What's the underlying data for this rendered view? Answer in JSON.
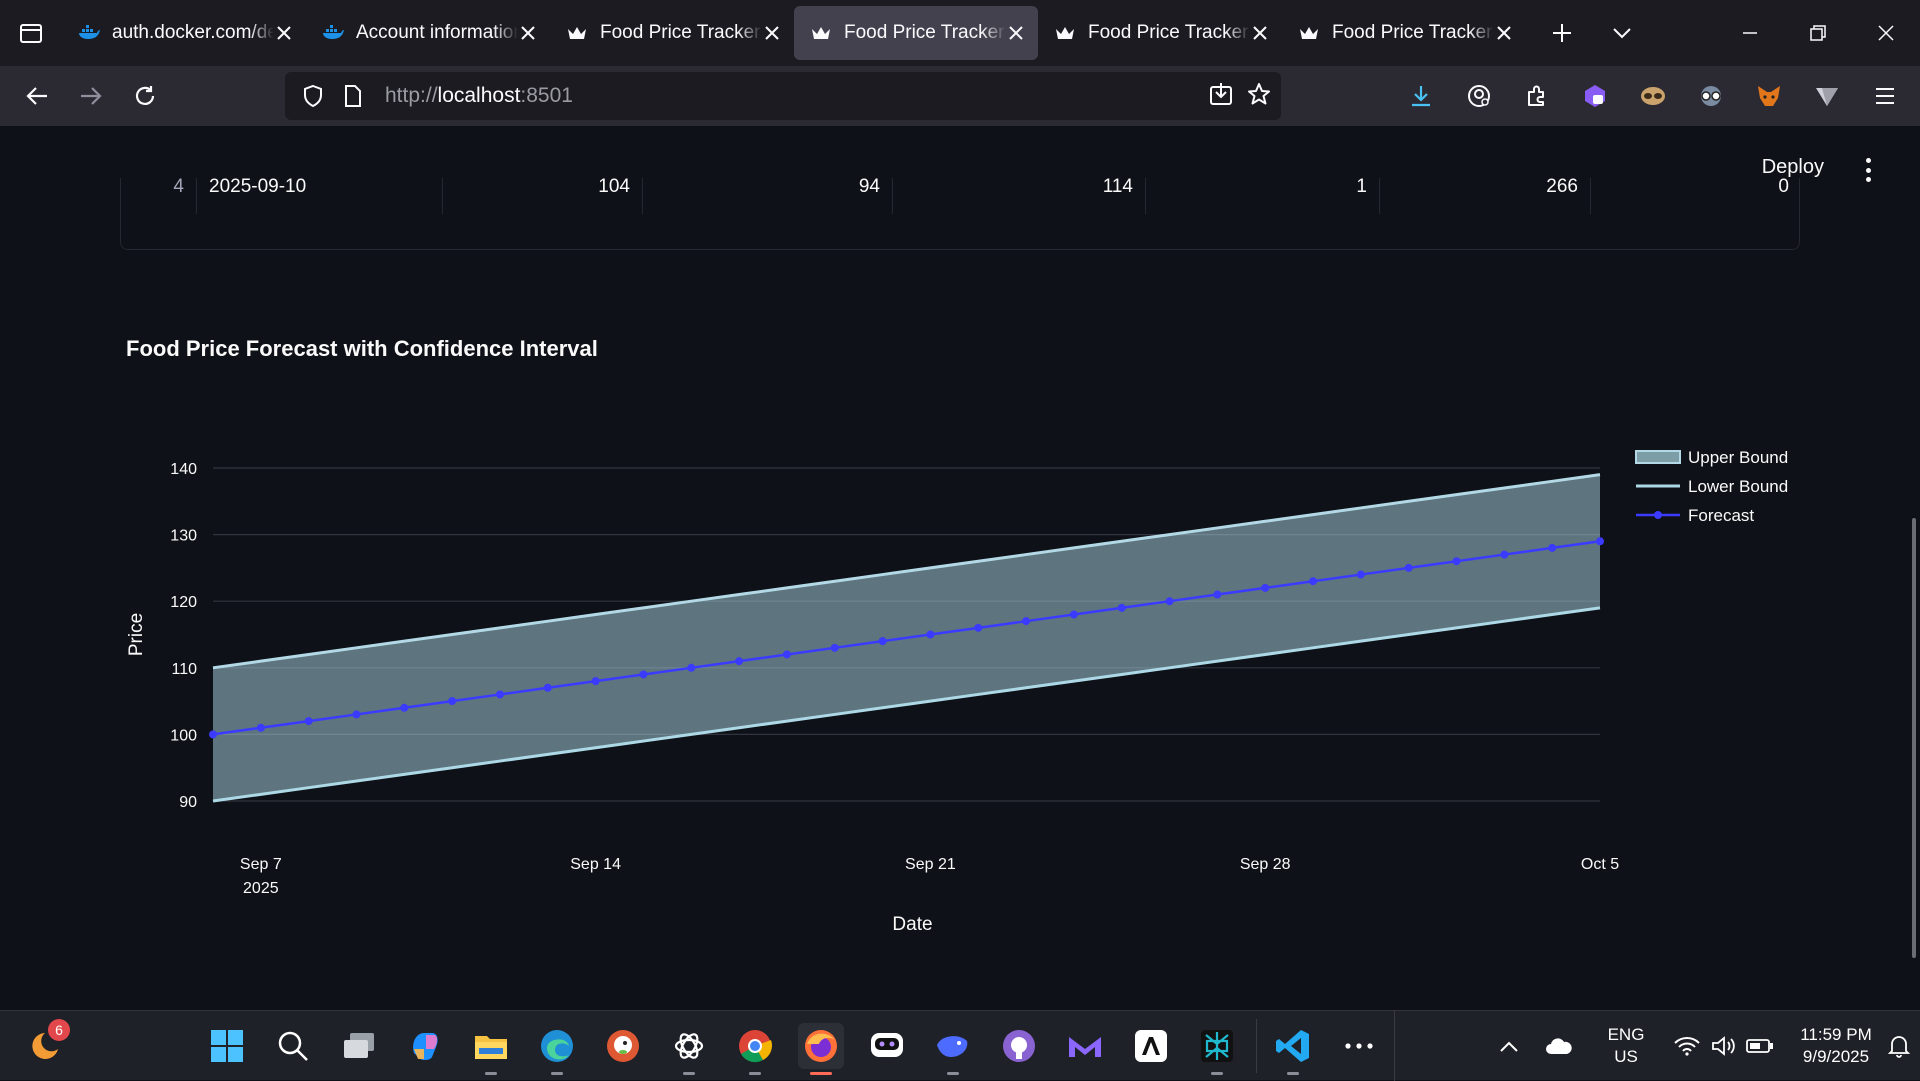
{
  "browser": {
    "tabs": [
      {
        "title": "auth.docker.com/de",
        "favicon": "docker-icon",
        "active": false
      },
      {
        "title": "Account information",
        "favicon": "docker-icon",
        "active": false
      },
      {
        "title": "Food Price Tracker D",
        "favicon": "streamlit-crown-icon",
        "active": false
      },
      {
        "title": "Food Price Tracker D",
        "favicon": "streamlit-crown-icon",
        "active": true
      },
      {
        "title": "Food Price Tracker D",
        "favicon": "streamlit-crown-icon",
        "active": false
      },
      {
        "title": "Food Price Tracker D",
        "favicon": "streamlit-crown-icon",
        "active": false
      }
    ],
    "url_prefix": "http://",
    "url_host": "localhost",
    "url_port": ":8501"
  },
  "app": {
    "deploy_label": "Deploy",
    "table_row": {
      "index": "4",
      "date": "2025-09-10",
      "values": [
        "104",
        "94",
        "114",
        "1",
        "266",
        "0"
      ]
    }
  },
  "chart_data": {
    "type": "line",
    "title": "Food Price Forecast with Confidence Interval",
    "xlabel": "Date",
    "ylabel": "Price",
    "x_start": "2025-09-06",
    "x_end": "2025-10-05",
    "xticks": [
      "Sep 7",
      "Sep 14",
      "Sep 21",
      "Sep 28",
      "Oct 5"
    ],
    "xtick_year": "2025",
    "ylim": [
      87,
      143
    ],
    "yticks": [
      90,
      100,
      110,
      120,
      130,
      140
    ],
    "grid": true,
    "legend_position": "top-right",
    "series": [
      {
        "name": "Upper Bound",
        "kind": "fill",
        "start": 110,
        "end": 139,
        "color": "#b3d9e6"
      },
      {
        "name": "Lower Bound",
        "kind": "line",
        "start": 90,
        "end": 119,
        "color": "#add8e6"
      },
      {
        "name": "Forecast",
        "kind": "line+markers",
        "start": 100,
        "end": 129,
        "points": 30,
        "color": "#3b3bff"
      }
    ]
  },
  "taskbar": {
    "notification_count": "6",
    "language": "ENG",
    "region": "US",
    "time": "11:59 PM",
    "date": "9/9/2025"
  }
}
